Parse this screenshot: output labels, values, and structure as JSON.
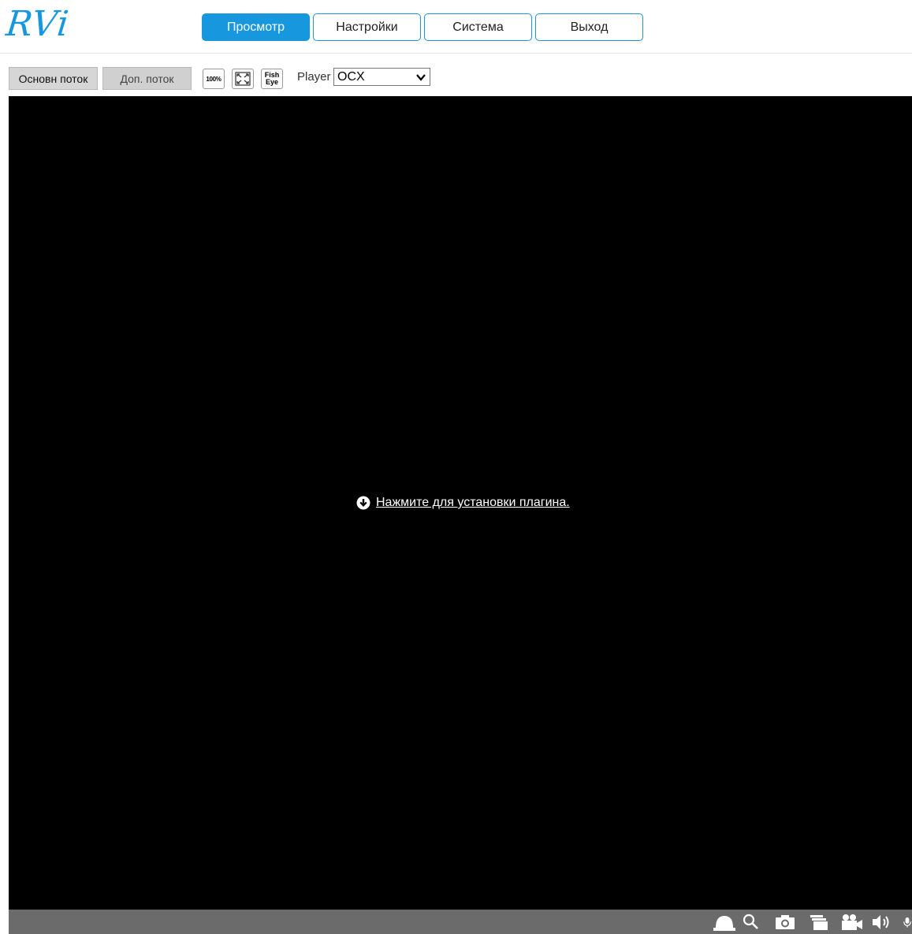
{
  "header": {
    "logo_text": "RVi",
    "brand_color": "#1798de",
    "tabs": [
      {
        "label": "Просмотр",
        "active": true
      },
      {
        "label": "Настройки",
        "active": false
      },
      {
        "label": "Система",
        "active": false
      },
      {
        "label": "Выход",
        "active": false
      }
    ]
  },
  "toolbar": {
    "main_stream_label": "Основн поток",
    "sub_stream_label": "Доп. поток",
    "zoom_100_label": "100%",
    "fullscreen_icon": "fullscreen-icon",
    "fisheye_label_line1": "Fish",
    "fisheye_label_line2": "Eye",
    "player_label": "Player",
    "player_selected": "OCX"
  },
  "video": {
    "background": "#000000",
    "plugin_link_text": "Нажмите для установки плагина.",
    "plugin_icon": "download-circle-icon"
  },
  "controlbar": {
    "background": "#6b6b6b",
    "icons": [
      "alarm-bell-icon",
      "zoom-search-icon",
      "snapshot-camera-icon",
      "multi-window-icon",
      "record-video-icon",
      "speaker-icon",
      "microphone-icon"
    ]
  }
}
